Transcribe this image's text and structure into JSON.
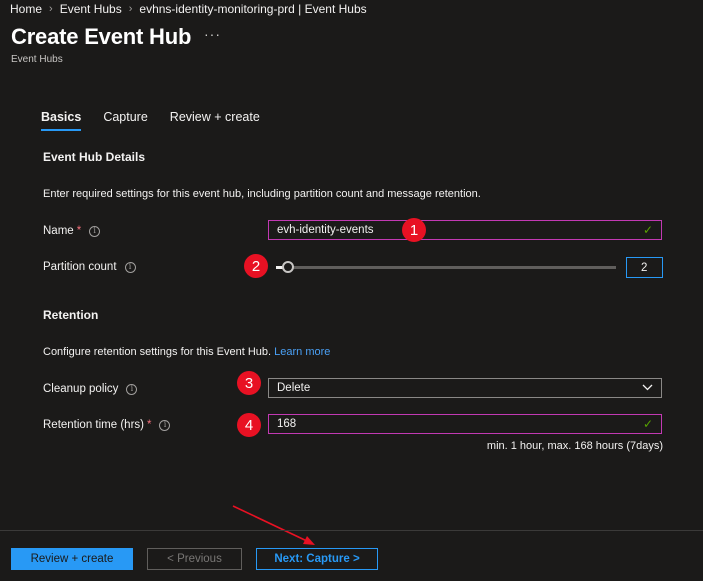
{
  "breadcrumb": {
    "items": [
      "Home",
      "Event Hubs",
      "evhns-identity-monitoring-prd | Event Hubs"
    ]
  },
  "header": {
    "title": "Create Event Hub",
    "more": "···",
    "subtitle": "Event Hubs"
  },
  "tabs": [
    {
      "label": "Basics",
      "active": true
    },
    {
      "label": "Capture",
      "active": false
    },
    {
      "label": "Review + create",
      "active": false
    }
  ],
  "details": {
    "heading": "Event Hub Details",
    "description": "Enter required settings for this event hub, including partition count and message retention."
  },
  "name_field": {
    "label": "Name",
    "required": "*",
    "value": "evh-identity-events",
    "valid_icon": "✓"
  },
  "partition": {
    "label": "Partition count",
    "value": "2"
  },
  "retention": {
    "heading": "Retention",
    "description": "Configure retention settings for this Event Hub.",
    "learn_more": "Learn more",
    "cleanup_label": "Cleanup policy",
    "cleanup_value": "Delete",
    "time_label": "Retention time (hrs)",
    "time_required": "*",
    "time_value": "168",
    "time_hint": "min. 1 hour, max. 168 hours (7days)"
  },
  "annotations": [
    "1",
    "2",
    "3",
    "4"
  ],
  "footer": {
    "review_create": "Review + create",
    "previous": "< Previous",
    "next": "Next: Capture >"
  },
  "colors": {
    "background": "#1b1a19",
    "accent": "#2899f5",
    "field_border": "#c239b3",
    "valid": "#57a300",
    "annotation": "#e81123",
    "arrow": "#e81123"
  }
}
